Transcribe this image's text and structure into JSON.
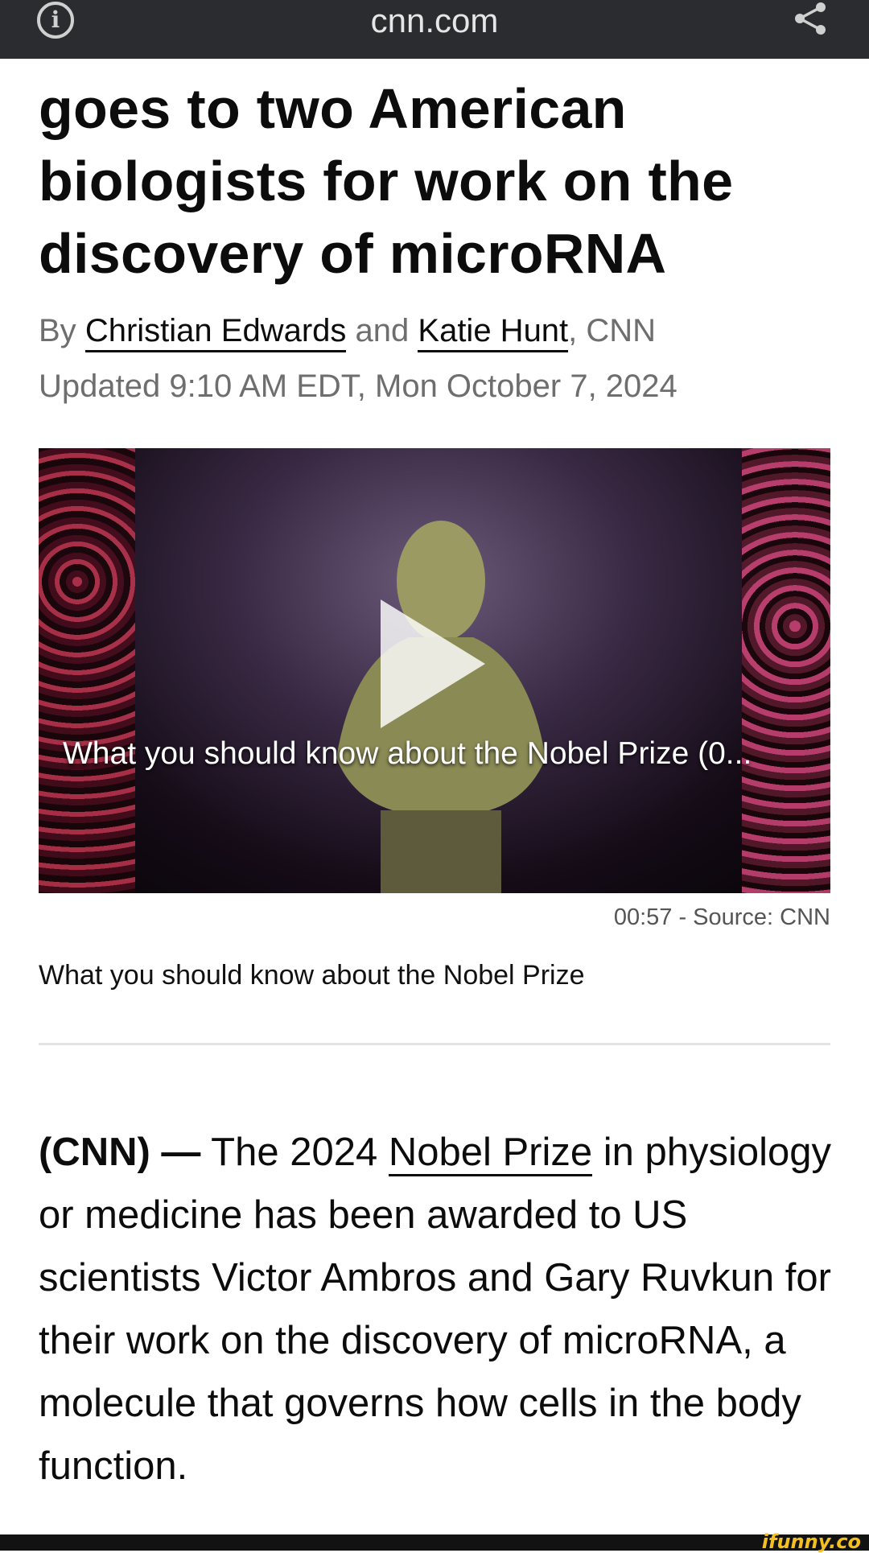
{
  "browser": {
    "url": "cnn.com",
    "icons": [
      "info-icon",
      "share-icon"
    ]
  },
  "article": {
    "headline": "goes to two American biologists for work on the discovery of microRNA",
    "byline_prefix": "By",
    "author_1": "Christian Edwards",
    "byline_and": "and",
    "author_2": "Katie Hunt",
    "byline_suffix": ", CNN",
    "updated": "Updated 9:10 AM EDT, Mon October 7, 2024",
    "video": {
      "overlay_title": "What you should know about the Nobel Prize (0...",
      "duration_source": "00:57 - Source: CNN",
      "caption": "What you should know about the Nobel Prize"
    },
    "body": {
      "dateline": "(CNN) —",
      "before_link": " The 2024 ",
      "link_text": "Nobel Prize",
      "after_link": " in physiology or medicine has been awarded to US scientists Victor Ambros and Gary Ruvkun for their work on the discovery of microRNA, a molecule that governs how cells in the body function."
    }
  },
  "watermark": "ifunny.co"
}
